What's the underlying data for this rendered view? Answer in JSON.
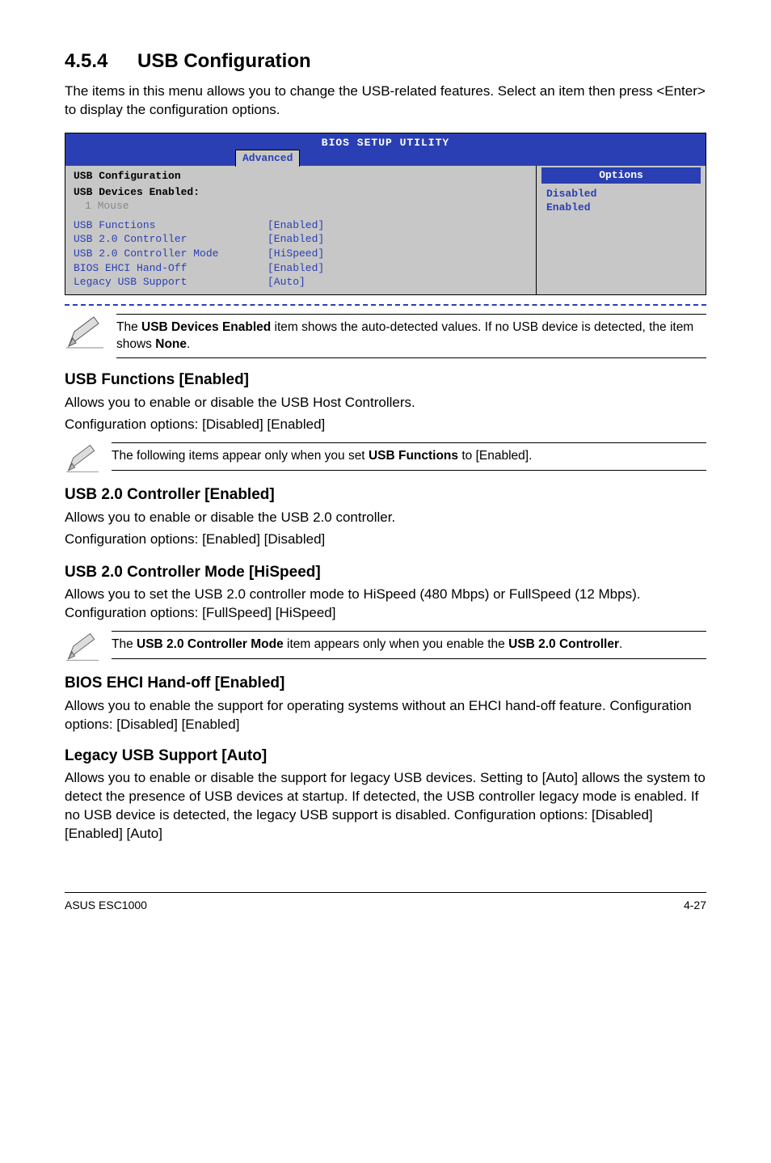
{
  "section": {
    "number": "4.5.4",
    "title": "USB Configuration"
  },
  "intro": "The items in this menu allows you to change the USB-related features. Select an item then press <Enter> to display the configuration options.",
  "bios": {
    "utility_title": "BIOS SETUP UTILITY",
    "tab": "Advanced",
    "panel_title": "USB Configuration",
    "devices_label": "USB Devices Enabled:",
    "devices_value": "1 Mouse",
    "rows": [
      {
        "k": "USB Functions",
        "v": "[Enabled]"
      },
      {
        "k": "USB 2.0 Controller",
        "v": "[Enabled]"
      },
      {
        "k": "USB 2.0 Controller Mode",
        "v": "[HiSpeed]"
      },
      {
        "k": "BIOS EHCI Hand-Off",
        "v": "[Enabled]"
      },
      {
        "k": "Legacy USB Support",
        "v": "[Auto]"
      }
    ],
    "options_header": "Options",
    "options": [
      "Disabled",
      "Enabled"
    ]
  },
  "note1_a": "The ",
  "note1_b": "USB Devices Enabled",
  "note1_c": " item shows the auto-detected values. If no USB device is detected, the item shows ",
  "note1_d": "None",
  "note1_e": ".",
  "usb_functions": {
    "heading": "USB Functions [Enabled]",
    "p1": "Allows you to enable or disable the USB Host Controllers.",
    "p2": "Configuration options: [Disabled] [Enabled]"
  },
  "note2_a": "The following items appear only when you set ",
  "note2_b": "USB Functions",
  "note2_c": " to [Enabled].",
  "usb20": {
    "heading": "USB 2.0 Controller [Enabled]",
    "p1": "Allows you to enable or disable the USB 2.0 controller.",
    "p2": "Configuration options: [Enabled] [Disabled]"
  },
  "usb20mode": {
    "heading": "USB 2.0 Controller Mode [HiSpeed]",
    "p1": "Allows you to set the USB 2.0 controller mode to HiSpeed (480 Mbps) or FullSpeed (12 Mbps). Configuration options: [FullSpeed] [HiSpeed]"
  },
  "note3_a": "The ",
  "note3_b": "USB 2.0 Controller Mode",
  "note3_c": " item appears only when you enable the ",
  "note3_d": "USB 2.0 Controller",
  "note3_e": ".",
  "ehci": {
    "heading": "BIOS EHCI Hand-off [Enabled]",
    "p1": "Allows you to enable the support for operating systems without an EHCI hand-off feature. Configuration options: [Disabled] [Enabled]"
  },
  "legacy": {
    "heading": "Legacy USB Support [Auto]",
    "p1": "Allows you to enable or disable the support for legacy USB devices. Setting to [Auto] allows the system to detect the presence of USB devices at startup. If detected, the USB controller legacy mode is enabled. If no USB device is detected, the legacy USB support is disabled. Configuration options: [Disabled] [Enabled] [Auto]"
  },
  "footer": {
    "left": "ASUS ESC1000",
    "right": "4-27"
  }
}
